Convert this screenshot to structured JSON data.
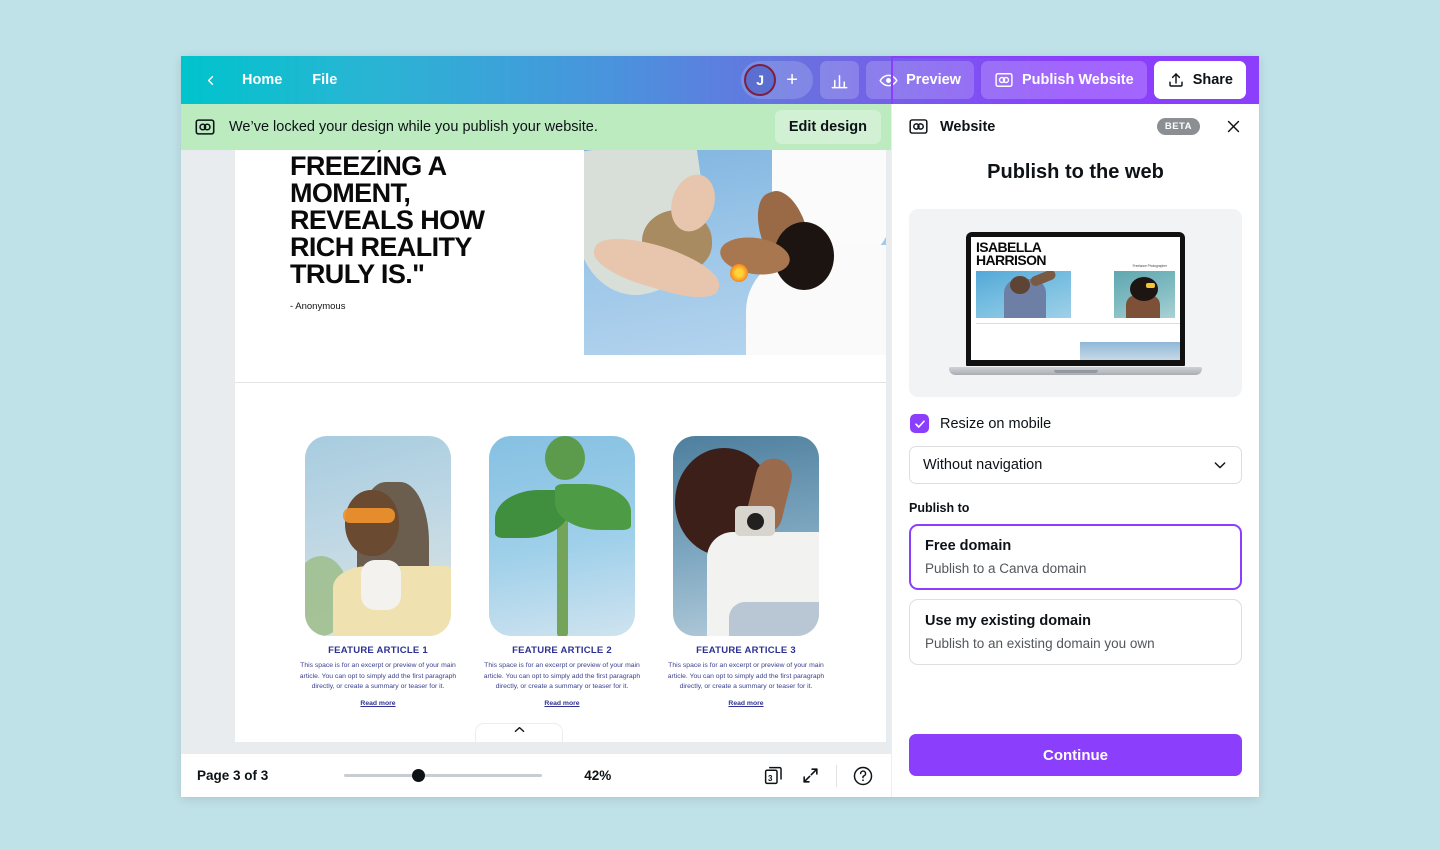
{
  "topbar": {
    "back_icon": "chevron-left-icon",
    "home_label": "Home",
    "file_label": "File",
    "avatar_initial": "J",
    "add_label": "+",
    "stats_icon": "bar-chart-icon",
    "preview_label": "Preview",
    "publish_label": "Publish Website",
    "share_label": "Share"
  },
  "notice": {
    "icon": "website-icon",
    "message": "We’ve locked your design while you publish your website.",
    "action_label": "Edit design"
  },
  "canvas": {
    "quote": "IMAGE,\nFREEZING A\nMOMENT,\nREVEALS HOW\nRICH REALITY\nTRULY IS.\"",
    "attribution": "- Anonymous",
    "cards": [
      {
        "title": "FEATURE ARTICLE 1",
        "body": "This space is for an excerpt or preview of your main article. You can opt to simply add the first paragraph directly, or create a summary or teaser for it.",
        "link": "Read more"
      },
      {
        "title": "FEATURE ARTICLE 2",
        "body": "This space is for an excerpt or preview of your main article. You can opt to simply add the first paragraph directly, or create a summary or teaser for it.",
        "link": "Read more"
      },
      {
        "title": "FEATURE ARTICLE 3",
        "body": "This space is for an excerpt or preview of your main article. You can opt to simply add the first paragraph directly, or create a summary or teaser for it.",
        "link": "Read more"
      }
    ]
  },
  "statusbar": {
    "page_count_label": "Page 3 of 3",
    "zoom_level": "42%",
    "pages_badge": "3",
    "pages_icon": "pages-icon",
    "expand_icon": "expand-icon",
    "help_icon": "help-circle-icon"
  },
  "panel": {
    "icon": "website-icon",
    "title": "Website",
    "badge": "BETA",
    "close_icon": "close-icon",
    "heading": "Publish to the web",
    "preview": {
      "site_title": "ISABELLA\nHARRISON",
      "site_subtitle": "Freelance Photographer"
    },
    "resize_label": "Resize on mobile",
    "resize_checked": true,
    "navigation_value": "Without navigation",
    "publish_to_label": "Publish to",
    "options": [
      {
        "title": "Free domain",
        "desc": "Publish to a Canva domain",
        "selected": true
      },
      {
        "title": "Use my existing domain",
        "desc": "Publish to an existing domain you own",
        "selected": false
      }
    ],
    "continue_label": "Continue"
  },
  "colors": {
    "accent_purple": "#8b3ffd",
    "notice_green": "#bdebc0",
    "page_background": "#bfe2e8",
    "article_text": "#2e3192"
  }
}
